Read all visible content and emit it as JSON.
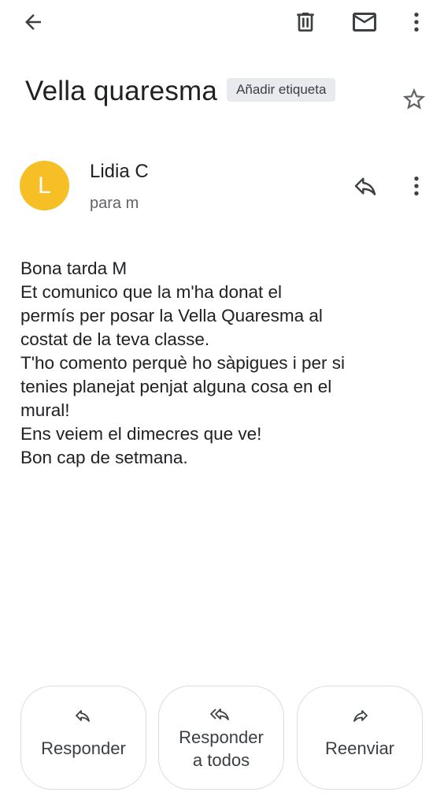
{
  "toolbar": {
    "back_icon": "arrow-back-icon",
    "delete_icon": "trash-icon",
    "mark_unread_icon": "mail-icon",
    "more_icon": "more-vert-icon"
  },
  "email": {
    "subject": "Vella quaresma",
    "add_label": "Añadir etiqueta",
    "star_icon": "star-outline-icon"
  },
  "sender": {
    "avatar_letter": "L",
    "avatar_color": "#f6bf26",
    "name": "Lidia C",
    "recipients": "para m"
  },
  "body": {
    "lines": [
      "Bona tarda M",
      "Et comunico que la         m'ha donat el",
      "permís per posar la Vella Quaresma al",
      "costat de la teva classe.",
      "T'ho comento perquè ho sàpigues i per si",
      "tenies planejat penjat alguna cosa en el",
      "mural!",
      "Ens veiem el dimecres que ve!",
      "Bon cap de setmana."
    ]
  },
  "actions": {
    "reply": "Responder",
    "reply_all_line1": "Responder",
    "reply_all_line2": "a todos",
    "forward": "Reenviar"
  }
}
